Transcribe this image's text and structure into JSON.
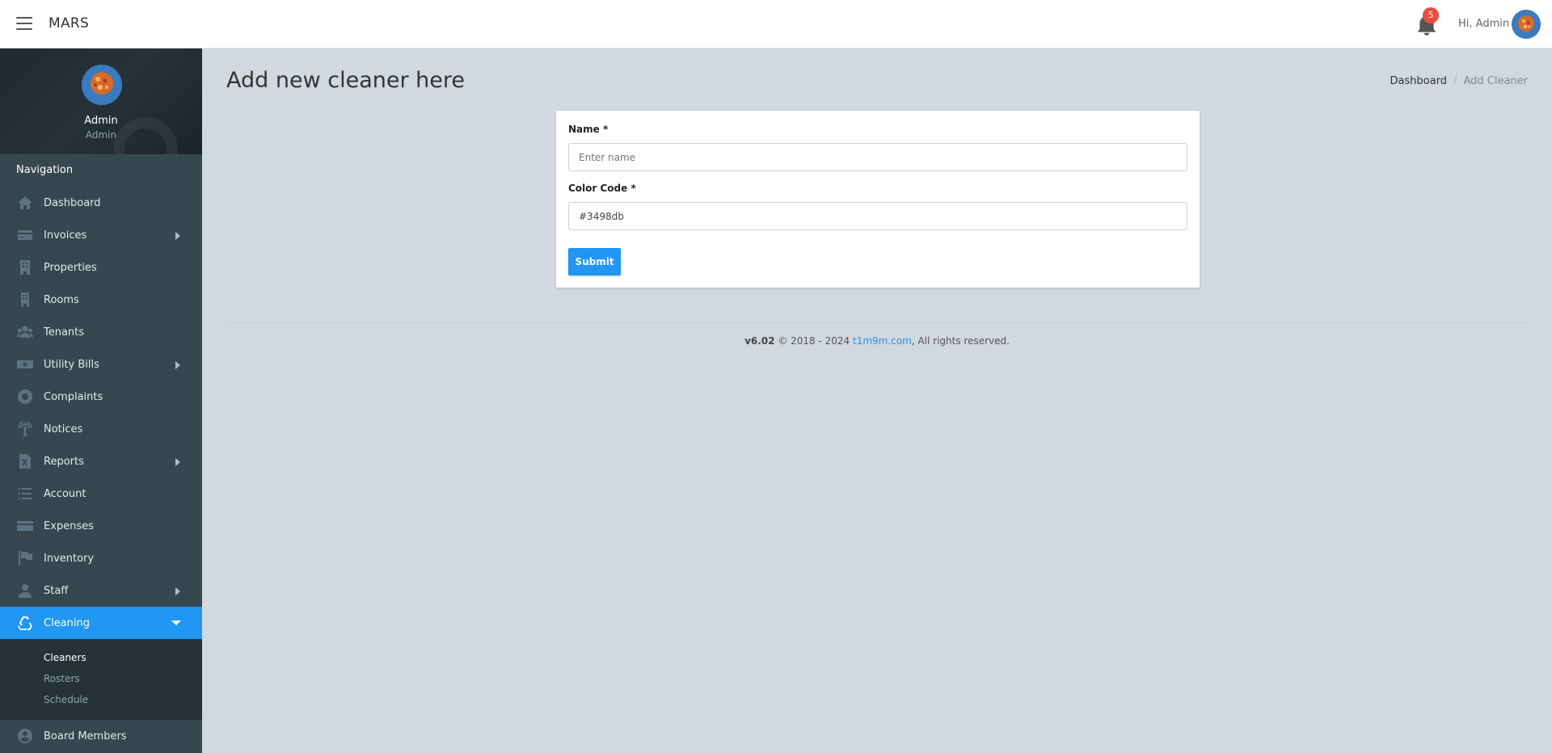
{
  "app": {
    "title": "MARS"
  },
  "header": {
    "notification_count": "5",
    "greeting": "Hi, Admin"
  },
  "profile": {
    "name": "Admin",
    "role": "Admin"
  },
  "nav": {
    "heading": "Navigation",
    "items": [
      {
        "label": "Dashboard",
        "icon": "home-icon"
      },
      {
        "label": "Invoices",
        "icon": "credit-card-icon",
        "has_submenu": true
      },
      {
        "label": "Properties",
        "icon": "building-icon"
      },
      {
        "label": "Rooms",
        "icon": "room-building-icon"
      },
      {
        "label": "Tenants",
        "icon": "users-icon"
      },
      {
        "label": "Utility Bills",
        "icon": "money-icon",
        "has_submenu": true
      },
      {
        "label": "Complaints",
        "icon": "lifebuoy-icon"
      },
      {
        "label": "Notices",
        "icon": "broadcast-icon"
      },
      {
        "label": "Reports",
        "icon": "excel-file-icon",
        "has_submenu": true
      },
      {
        "label": "Account",
        "icon": "list-icon"
      },
      {
        "label": "Expenses",
        "icon": "card-icon"
      },
      {
        "label": "Inventory",
        "icon": "flag-icon"
      },
      {
        "label": "Staff",
        "icon": "user-icon",
        "has_submenu": true
      },
      {
        "label": "Cleaning",
        "icon": "recycle-icon",
        "active": true
      }
    ],
    "cleaning_sub": [
      {
        "label": "Cleaners",
        "current": true
      },
      {
        "label": "Rosters"
      },
      {
        "label": "Schedule"
      }
    ],
    "after": [
      {
        "label": "Board Members",
        "icon": "user-circle-icon"
      }
    ]
  },
  "page": {
    "title": "Add new cleaner here",
    "breadcrumb": {
      "home": "Dashboard",
      "current": "Add Cleaner"
    }
  },
  "form": {
    "name_label": "Name *",
    "name_placeholder": "Enter name",
    "name_value": "",
    "color_label": "Color Code *",
    "color_value": "#3498db",
    "submit_label": "Submit"
  },
  "footer": {
    "version": "v6.02",
    "copyright": "© 2018 - 2024",
    "link": "t1m9m.com",
    "rights": ", All rights reserved."
  },
  "colors": {
    "accent": "#2196f3",
    "sidebar": "#37474f",
    "badge": "#ef4c3e"
  }
}
